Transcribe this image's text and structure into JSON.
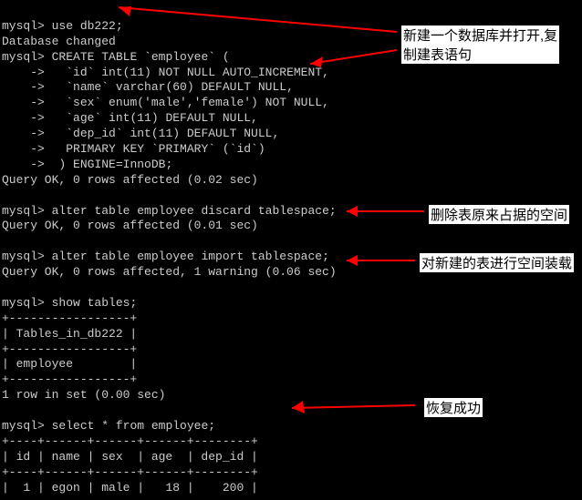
{
  "prompt": "mysql>",
  "cont": "    ->",
  "cmd_use": "use db222;",
  "res_dbchanged": "Database changed",
  "cmd_create": "CREATE TABLE `employee` (",
  "create_l1": "  `id` int(11) NOT NULL AUTO_INCREMENT,",
  "create_l2": "  `name` varchar(60) DEFAULT NULL,",
  "create_l3": "  `sex` enum('male','female') NOT NULL,",
  "create_l4": "  `age` int(11) DEFAULT NULL,",
  "create_l5": "  `dep_id` int(11) DEFAULT NULL,",
  "create_l6": "  PRIMARY KEY `PRIMARY` (`id`)",
  "create_l7": " ) ENGINE=InnoDB;",
  "res_create": "Query OK, 0 rows affected (0.02 sec)",
  "cmd_discard": "alter table employee discard tablespace;",
  "res_discard": "Query OK, 0 rows affected (0.01 sec)",
  "cmd_import": "alter table employee import tablespace;",
  "res_import": "Query OK, 0 rows affected, 1 warning (0.06 sec)",
  "cmd_show": "show tables;",
  "tbl_border": "+-----------------+",
  "tbl_header": "| Tables_in_db222 |",
  "tbl_row": "| employee        |",
  "res_show": "1 row in set (0.00 sec)",
  "cmd_select": "select * from employee;",
  "sel_border": "+----+------+------+------+--------+",
  "sel_header": "| id | name | sex  | age  | dep_id |",
  "sel_row1": "|  1 | egon | male |   18 |    200 |",
  "anno1": "新建一个数据库并打开,复",
  "anno1b": "制建表语句",
  "anno2": "删除表原来占据的空间",
  "anno3": "对新建的表进行空间装载",
  "anno4": "恢复成功"
}
